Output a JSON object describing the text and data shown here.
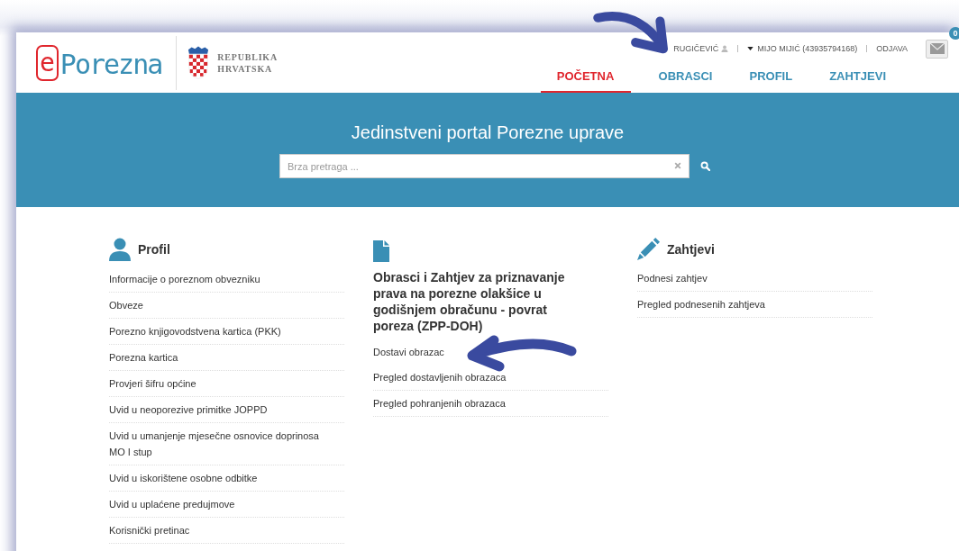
{
  "header": {
    "logo": {
      "letter": "e",
      "name": "Porezna"
    },
    "coat_of_arms_text": [
      "REPUBLIKA",
      "HRVATSKA"
    ],
    "user_bar": {
      "username": "RUGIČEVIĆ",
      "taxpayer": "MIJO MIJIĆ (43935794168)",
      "logout": "ODJAVA"
    },
    "messages": {
      "count": "0"
    },
    "nav": [
      {
        "label": "POČETNA",
        "selected": true
      },
      {
        "label": "OBRASCI",
        "selected": false
      },
      {
        "label": "PROFIL",
        "selected": false
      },
      {
        "label": "ZAHTJEVI",
        "selected": false
      }
    ]
  },
  "banner": {
    "title": "Jedinstveni portal Porezne uprave",
    "search": {
      "placeholder": "Brza pretraga ..."
    }
  },
  "sections": [
    {
      "kind": "profile",
      "title": "Profil",
      "items": [
        "Informacije o poreznom obvezniku",
        "Obveze",
        "Porezno knjigovodstvena kartica (PKK)",
        "Porezna kartica",
        "Provjeri šifru općine",
        "Uvid u neoporezive primitke JOPPD",
        "Uvid u umanjenje mjesečne osnovice doprinosa MO I stup",
        "Uvid u iskorištene osobne odbitke",
        "Uvid u uplaćene predujmove",
        "Korisnički pretinac"
      ]
    },
    {
      "kind": "forms",
      "title": "Obrasci i Zahtjev za priznavanje prava na porezne olakšice u godišnjem obračunu - povrat poreza (ZPP-DOH)",
      "items": [
        "Dostavi obrazac",
        "Pregled dostavljenih obrazaca",
        "Pregled pohranjenih obrazaca"
      ]
    },
    {
      "kind": "requests",
      "title": "Zahtjevi",
      "items": [
        "Podnesi zahtjev",
        "Pregled podnesenih zahtjeva"
      ]
    }
  ]
}
